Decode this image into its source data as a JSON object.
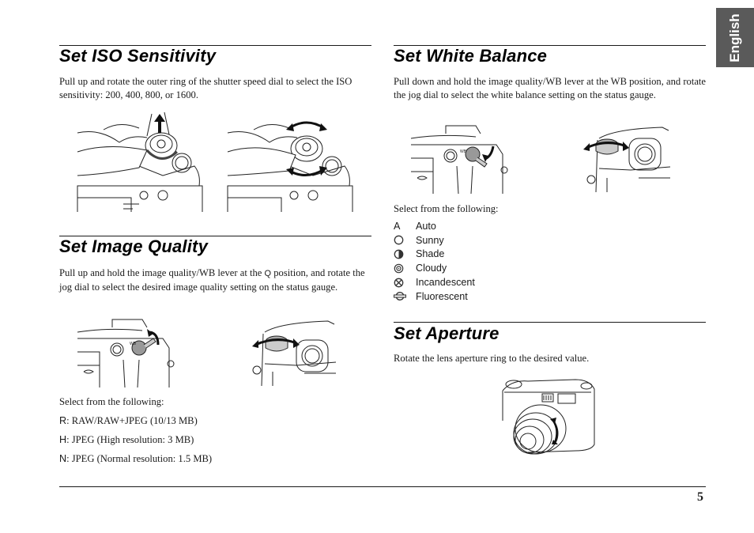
{
  "language_tab": "English",
  "page_number": "5",
  "sections": {
    "iso": {
      "title": "Set ISO Sensitivity",
      "body": "Pull up and rotate the outer ring of the shutter speed dial to select the ISO sensitivity: 200, 400, 800, or 1600.",
      "figures": [
        "pull-up-dial-illustration",
        "rotate-dial-illustration"
      ]
    },
    "quality": {
      "title": "Set Image Quality",
      "body_before": "Pull up and hold the image quality/WB lever at the ",
      "body_symbol": "Q",
      "body_after": " position, and rotate the jog dial to select the desired image quality setting on the status gauge.",
      "select_intro": "Select from the following:",
      "options": [
        {
          "code": "R",
          "text": ": RAW/RAW+JPEG (10/13 MB)"
        },
        {
          "code": "H",
          "text": ": JPEG (High resolution: 3 MB)"
        },
        {
          "code": "N",
          "text": ": JPEG (Normal resolution: 1.5 MB)"
        }
      ],
      "lever_label": "WB"
    },
    "white_balance": {
      "title": "Set White Balance",
      "body": "Pull down and hold the image quality/WB lever at the WB position, and rotate the jog dial to select the white balance setting on the status gauge.",
      "select_intro": "Select from the following:",
      "options": [
        {
          "icon": "auto-letter",
          "glyph": "A",
          "label": "Auto"
        },
        {
          "icon": "sunny-icon",
          "label": "Sunny"
        },
        {
          "icon": "shade-icon",
          "label": "Shade"
        },
        {
          "icon": "cloudy-icon",
          "label": "Cloudy"
        },
        {
          "icon": "incandescent-icon",
          "label": "Incandescent"
        },
        {
          "icon": "fluorescent-icon",
          "label": "Fluorescent"
        }
      ],
      "lever_label": "WB"
    },
    "aperture": {
      "title": "Set Aperture",
      "body": "Rotate the lens aperture ring to the desired value."
    }
  }
}
